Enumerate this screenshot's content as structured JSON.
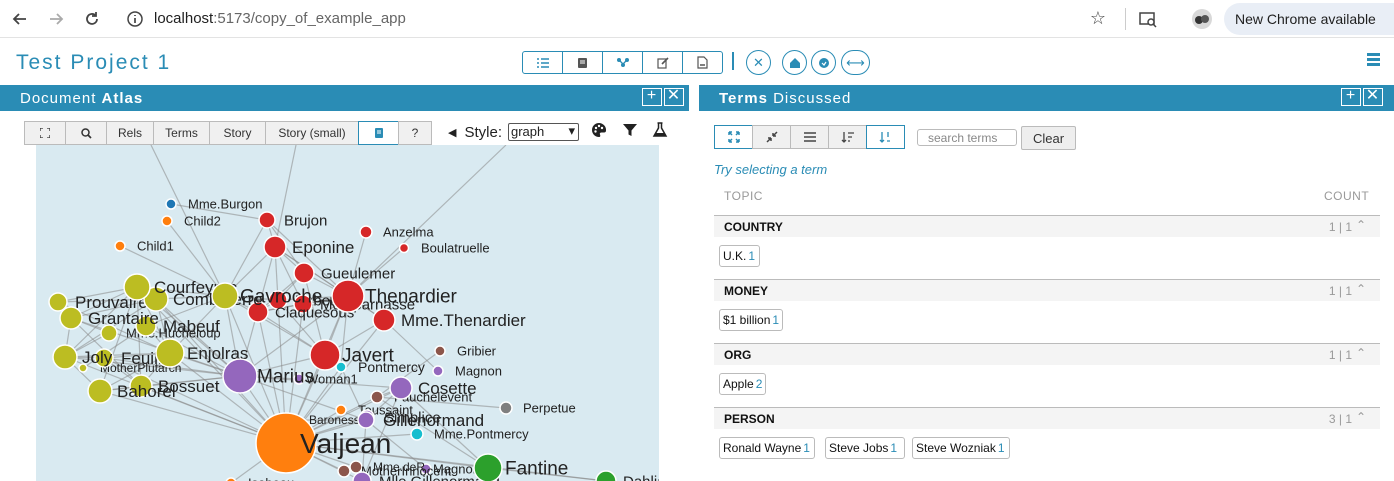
{
  "browser": {
    "url_host": "localhost",
    "url_rest": ":5173/copy_of_example_app",
    "new_chrome": "New Chrome available"
  },
  "app": {
    "title": "Test Project 1"
  },
  "left_panel": {
    "title_a": "Document",
    "title_b": "Atlas",
    "tabs": [
      "Rels",
      "Terms",
      "Story",
      "Story (small)",
      "?"
    ],
    "style_label": "Style:",
    "style_value": "graph"
  },
  "graph": {
    "nodes": [
      {
        "label": "Mme.Burgon",
        "color": "#1f77b4"
      },
      {
        "label": "Child2",
        "color": "#ff7f0e"
      },
      {
        "label": "Child1",
        "color": "#ff7f0e"
      },
      {
        "label": "Brujon",
        "color": "#d62728"
      },
      {
        "label": "Anzelma",
        "color": "#d62728"
      },
      {
        "label": "Eponine",
        "color": "#d62728"
      },
      {
        "label": "Boulatruelle",
        "color": "#d62728"
      },
      {
        "label": "Gueulemer",
        "color": "#d62728"
      },
      {
        "label": "Courfeyrac",
        "color": "#bcbd22"
      },
      {
        "label": "Prouvaire",
        "color": "#bcbd22"
      },
      {
        "label": "Combeferre",
        "color": "#bcbd22"
      },
      {
        "label": "Gavroche",
        "color": "#bcbd22"
      },
      {
        "label": "Babet",
        "color": "#d62728"
      },
      {
        "label": "Thenardier",
        "color": "#d62728"
      },
      {
        "label": "Montparnasse",
        "color": "#d62728"
      },
      {
        "label": "Claquesous",
        "color": "#d62728"
      },
      {
        "label": "Mme.Thenardier",
        "color": "#d62728"
      },
      {
        "label": "Grantaire",
        "color": "#bcbd22"
      },
      {
        "label": "Mabeuf",
        "color": "#bcbd22"
      },
      {
        "label": "Mme.Hucheloup",
        "color": "#bcbd22"
      },
      {
        "label": "Joly",
        "color": "#bcbd22"
      },
      {
        "label": "Feuilly",
        "color": "#bcbd22"
      },
      {
        "label": "Enjolras",
        "color": "#bcbd22"
      },
      {
        "label": "Javert",
        "color": "#d62728"
      },
      {
        "label": "Gribier",
        "color": "#8c564b"
      },
      {
        "label": "MotherPlutarch",
        "color": "#bcbd22"
      },
      {
        "label": "Pontmercy",
        "color": "#17becf"
      },
      {
        "label": "Magnon",
        "color": "#9467bd"
      },
      {
        "label": "Bossuet",
        "color": "#bcbd22"
      },
      {
        "label": "Marius",
        "color": "#9467bd"
      },
      {
        "label": "Woman1",
        "color": "#9467bd"
      },
      {
        "label": "Bahorel",
        "color": "#bcbd22"
      },
      {
        "label": "Cosette",
        "color": "#9467bd"
      },
      {
        "label": "Fauchelevent",
        "color": "#8c564b"
      },
      {
        "label": "Perpetue",
        "color": "#7f7f7f"
      },
      {
        "label": "Toussaint",
        "color": "#ff7f0e"
      },
      {
        "label": "Simplice",
        "color": "#9467bd"
      },
      {
        "label": "Gillenormand",
        "color": "#9467bd"
      },
      {
        "label": "BaronessT",
        "color": "#9467bd"
      },
      {
        "label": "Mme.Pontmercy",
        "color": "#17becf"
      },
      {
        "label": "Valjean",
        "color": "#ff7f0e"
      },
      {
        "label": "Fantine",
        "color": "#2ca02c"
      },
      {
        "label": "Mme.deR",
        "color": "#8c564b"
      },
      {
        "label": "MotherInnocent",
        "color": "#8c564b"
      },
      {
        "label": "Magnon",
        "color": "#9467bd"
      },
      {
        "label": "Mlle.Gillenormand",
        "color": "#9467bd"
      },
      {
        "label": "Dahlia",
        "color": "#2ca02c"
      },
      {
        "label": "Isabeau",
        "color": "#ff7f0e"
      }
    ]
  },
  "right_panel": {
    "title_a": "Terms",
    "title_b": "Discussed",
    "search_placeholder": "search terms",
    "clear_label": "Clear",
    "hint": "Try selecting a term",
    "col_topic": "TOPIC",
    "col_count": "COUNT",
    "categories": [
      {
        "name": "COUNTRY",
        "count": "1 | 1",
        "terms": [
          {
            "label": "U.K.",
            "n": "1"
          }
        ]
      },
      {
        "name": "MONEY",
        "count": "1 | 1",
        "terms": [
          {
            "label": "$1 billion",
            "n": "1"
          }
        ]
      },
      {
        "name": "ORG",
        "count": "1 | 1",
        "terms": [
          {
            "label": "Apple",
            "n": "2"
          }
        ]
      },
      {
        "name": "PERSON",
        "count": "3 | 1",
        "terms": [
          {
            "label": "Ronald Wayne",
            "n": "1"
          },
          {
            "label": "Steve Jobs",
            "n": "1"
          },
          {
            "label": "Steve Wozniak",
            "n": "1"
          }
        ]
      }
    ]
  },
  "colors": {
    "accent": "#2a8cb5",
    "graph_bg": "#d9eaf1"
  }
}
